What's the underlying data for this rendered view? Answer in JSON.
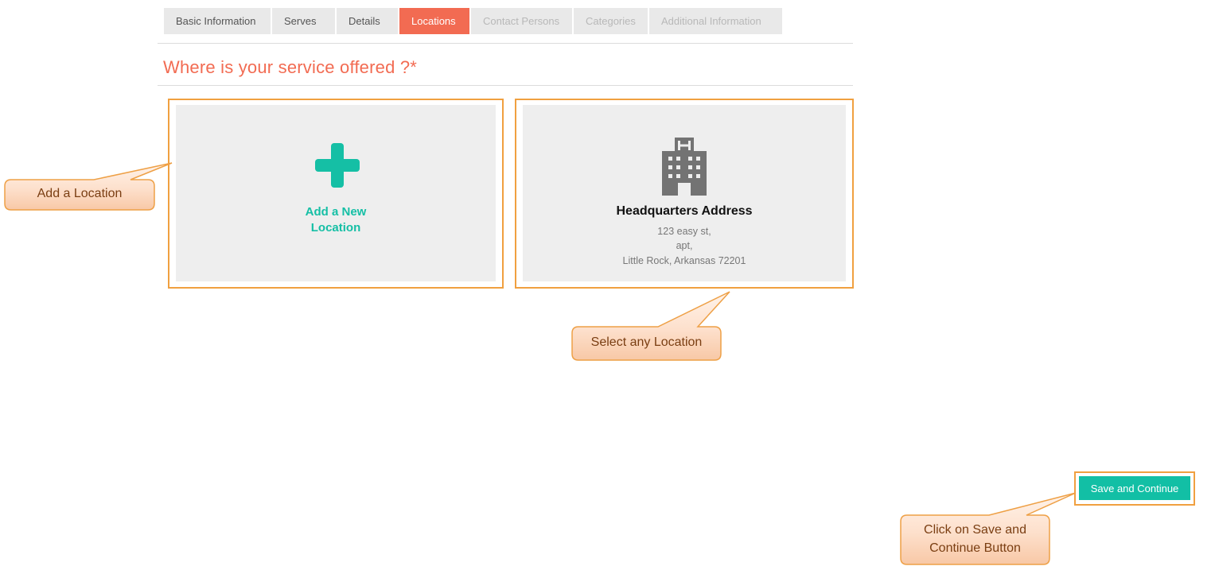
{
  "tabs": [
    {
      "label": "Basic Information",
      "state": "normal"
    },
    {
      "label": "Serves",
      "state": "normal"
    },
    {
      "label": "Details",
      "state": "normal"
    },
    {
      "label": "Locations",
      "state": "active"
    },
    {
      "label": "Contact Persons",
      "state": "disabled"
    },
    {
      "label": "Categories",
      "state": "disabled"
    },
    {
      "label": "Additional Information",
      "state": "disabled"
    }
  ],
  "section": {
    "title": "Where is your service offered ?*"
  },
  "add_card": {
    "label_line1": "Add a New",
    "label_line2": "Location",
    "icon": "plus-icon"
  },
  "location_card": {
    "title": "Headquarters Address",
    "line1": "123 easy st,",
    "line2": "apt,",
    "line3": "Little Rock, Arkansas 72201",
    "icon": "building-icon"
  },
  "save_button": {
    "label": "Save and Continue"
  },
  "callouts": {
    "add_location": "Add a Location",
    "select_location": "Select any Location",
    "save_line1": "Click on Save and",
    "save_line2": "Continue Button"
  },
  "colors": {
    "accent": "#f26b52",
    "teal": "#12bfa5",
    "highlight": "#f0a040"
  }
}
